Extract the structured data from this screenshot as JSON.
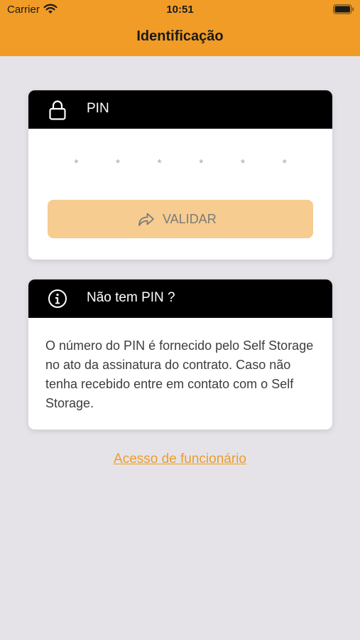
{
  "status_bar": {
    "carrier": "Carrier",
    "time": "10:51",
    "wifi_icon": "wifi-icon",
    "battery_icon": "battery-icon"
  },
  "nav": {
    "title": "Identificação",
    "background_color": "#f09c27"
  },
  "pin_card": {
    "header_icon": "lock-icon",
    "header_title": "PIN",
    "pin_value": "* * * * * *",
    "validate_icon": "share-arrow-icon",
    "validate_label": "VALIDAR",
    "validate_button_color": "#f6cc91"
  },
  "info_card": {
    "header_icon": "info-icon",
    "header_title": "Não tem PIN ?",
    "body": "O número do PIN é fornecido pelo Self Storage no ato da assinatura do contrato. Caso não tenha recebido entre em contato com o Self Storage."
  },
  "footer": {
    "employee_link": "Acesso de funcionário",
    "link_color": "#f09c27"
  }
}
